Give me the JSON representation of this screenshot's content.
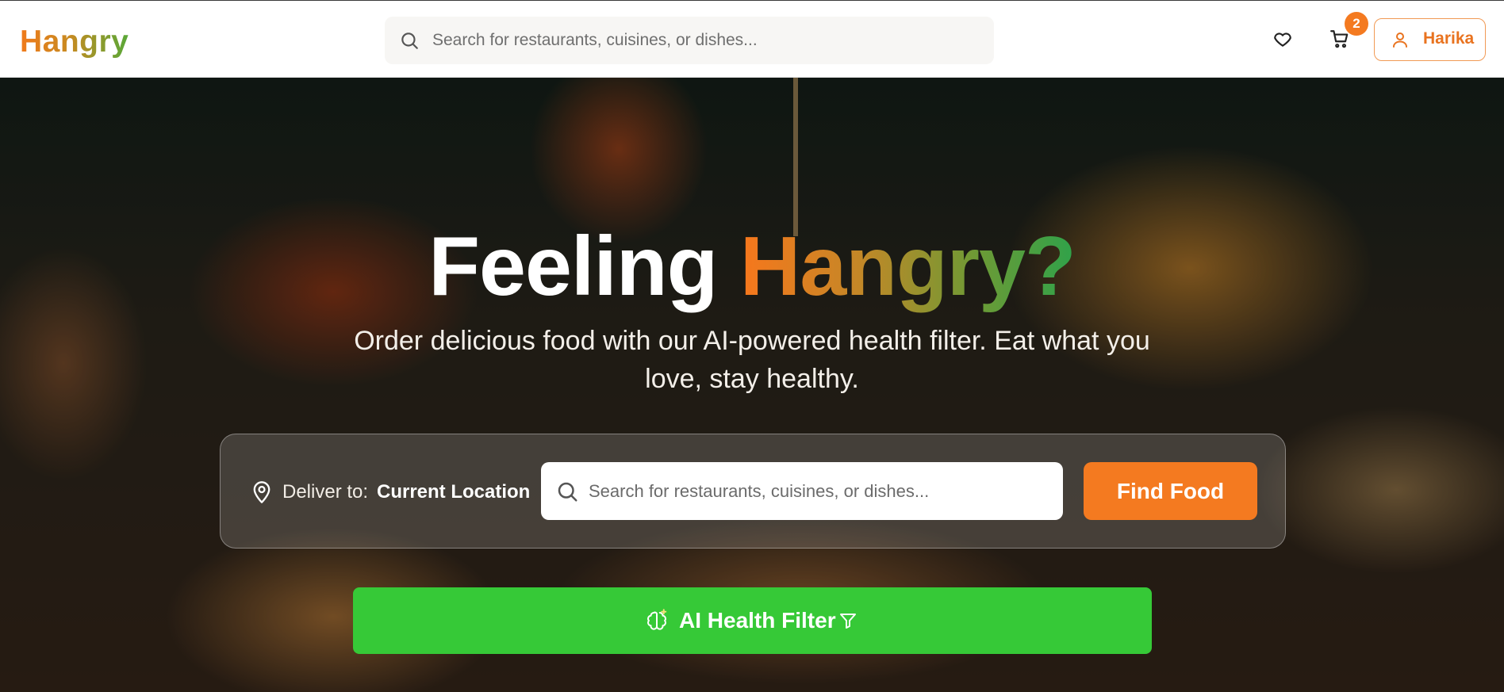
{
  "brand": {
    "name": "Hangry"
  },
  "nav": {
    "search_placeholder": "Search for restaurants, cuisines, or dishes...",
    "cart_count": "2",
    "user_name": "Harika"
  },
  "hero": {
    "title_prefix": "Feeling ",
    "title_highlight": "Hangry?",
    "subtitle": "Order delicious food with our AI-powered health filter. Eat what you love, stay healthy.",
    "deliver_label": "Deliver to:",
    "deliver_value": "Current Location",
    "search_placeholder": "Search for restaurants, cuisines, or dishes...",
    "find_button": "Find Food",
    "ai_button": "AI Health Filter"
  },
  "icons": {
    "search": "search-icon",
    "heart": "heart-icon",
    "cart": "cart-icon",
    "user": "user-icon",
    "location": "map-pin-icon",
    "brain": "brain-icon",
    "filter": "filter-icon"
  },
  "colors": {
    "accent_orange": "#f47a20",
    "ai_green": "#36c937",
    "brand_gradient": [
      "#f07a1b",
      "#58a838"
    ]
  }
}
